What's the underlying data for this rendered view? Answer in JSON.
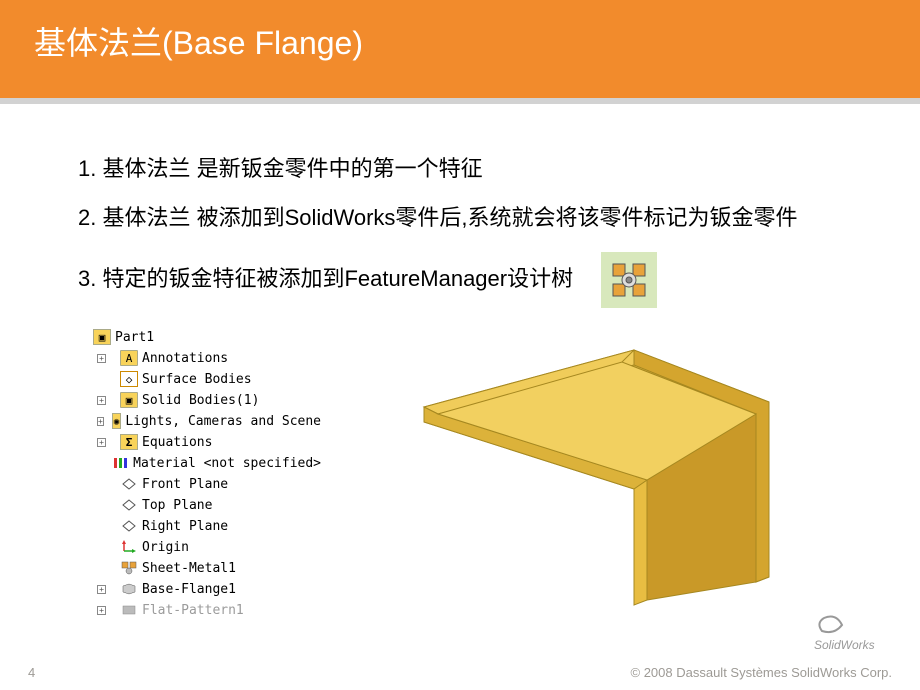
{
  "header": {
    "title": "基体法兰(Base Flange)"
  },
  "points": {
    "p1": "1.  基体法兰  是新钣金零件中的第一个特征",
    "p2": "2.  基体法兰  被添加到SolidWorks零件后,系统就会将该零件标记为钣金零件",
    "p3": "3.  特定的钣金特征被添加到FeatureManager设计树"
  },
  "tree": {
    "root": "Part1",
    "items": [
      "Annotations",
      "Surface Bodies",
      "Solid Bodies(1)",
      "Lights, Cameras and Scene",
      "Equations",
      "Material <not specified>",
      "Front Plane",
      "Top Plane",
      "Right Plane",
      "Origin",
      "Sheet-Metal1",
      "Base-Flange1",
      "Flat-Pattern1"
    ]
  },
  "footer": {
    "page": "4",
    "copyright": "© 2008 Dassault Systèmes SolidWorks Corp."
  },
  "logo_text": "SolidWorks"
}
